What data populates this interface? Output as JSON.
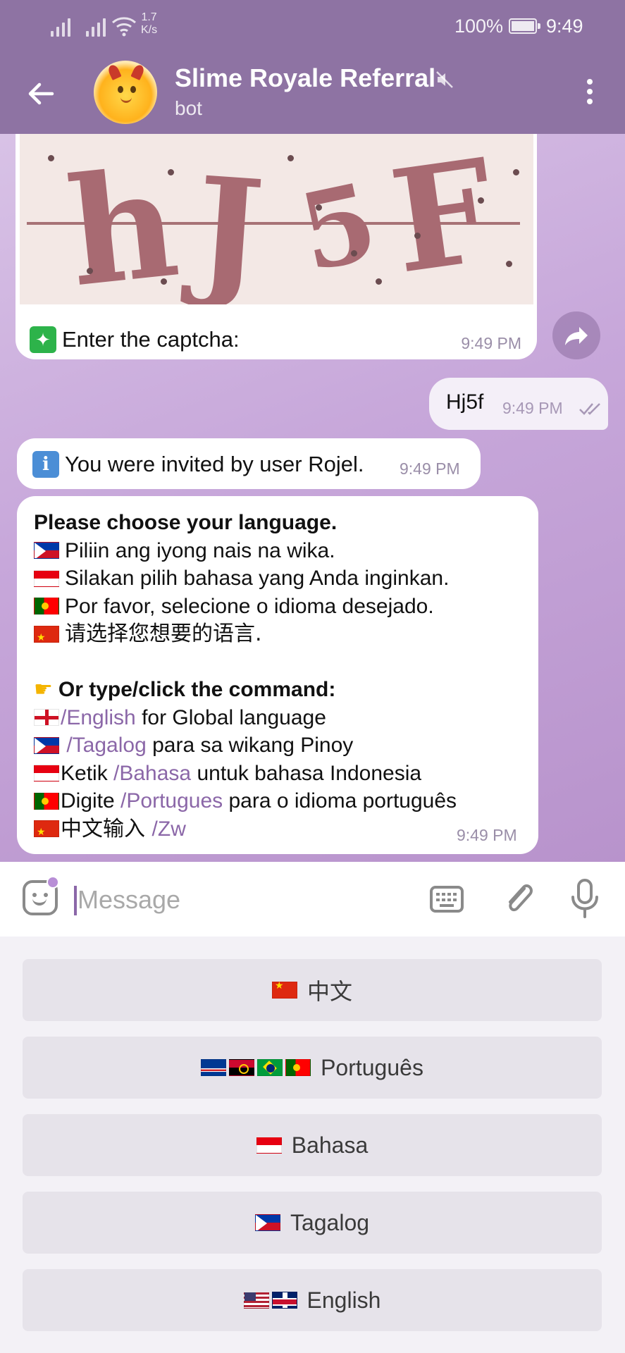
{
  "status_bar": {
    "speed_value": "1.7",
    "speed_unit": "K/s",
    "battery": "100%",
    "time": "9:49"
  },
  "header": {
    "title": "Slime Royale Referral",
    "subtitle": "bot",
    "icons": {
      "back": "arrow-left-icon",
      "mute": "muted-speaker-icon",
      "menu": "more-vertical-icon"
    }
  },
  "messages": {
    "captcha": {
      "image_text": [
        "h",
        "J",
        "5",
        "F"
      ],
      "emoji": "✦",
      "caption": "Enter the captcha:",
      "time": "9:49 PM"
    },
    "user_reply": {
      "text": "Hj5f",
      "time": "9:49 PM",
      "status": "read"
    },
    "invited": {
      "icon": "i",
      "text": "You were invited by user Rojel.",
      "time": "9:49 PM"
    },
    "language_prompt": {
      "heading": "Please choose your language.",
      "translations": [
        {
          "flag": "ph",
          "text": "Piliin ang iyong nais na wika."
        },
        {
          "flag": "id",
          "text": "Silakan pilih bahasa yang Anda inginkan."
        },
        {
          "flag": "pt",
          "text": "Por favor, selecione o idioma desejado."
        },
        {
          "flag": "cn",
          "text": "请选择您想要的语言."
        }
      ],
      "command_heading": "Or type/click the command:",
      "commands": [
        {
          "flag": "en",
          "prefix": "",
          "command": "/English",
          "suffix": " for Global language"
        },
        {
          "flag": "ph",
          "prefix": " ",
          "command": "/Tagalog",
          "suffix": " para sa wikang Pinoy"
        },
        {
          "flag": "id",
          "prefix": "Ketik ",
          "command": "/Bahasa",
          "suffix": " untuk bahasa Indonesia"
        },
        {
          "flag": "pt",
          "prefix": "Digite ",
          "command": "/Portugues",
          "suffix": " para o idioma português"
        },
        {
          "flag": "cn",
          "prefix": "中文输入 ",
          "command": "/Zw",
          "suffix": ""
        }
      ],
      "time": "9:49 PM"
    }
  },
  "input": {
    "placeholder": "Message",
    "icons": {
      "sticker": "sticker-smile-icon",
      "keyboard": "keyboard-icon",
      "attach": "paperclip-icon",
      "mic": "microphone-icon"
    }
  },
  "reply_keyboard": [
    {
      "flags": [
        "cn"
      ],
      "label": "中文"
    },
    {
      "flags": [
        "cv",
        "ao",
        "br",
        "pt"
      ],
      "label": "Português"
    },
    {
      "flags": [
        "id"
      ],
      "label": "Bahasa"
    },
    {
      "flags": [
        "ph"
      ],
      "label": "Tagalog"
    },
    {
      "flags": [
        "us",
        "uk"
      ],
      "label": "English"
    }
  ],
  "colors": {
    "header": "#8e73a3",
    "accent": "#8b67a8",
    "chat_bg": "#c7a7da",
    "bubble": "#ffffff",
    "button": "#e6e3ea"
  }
}
